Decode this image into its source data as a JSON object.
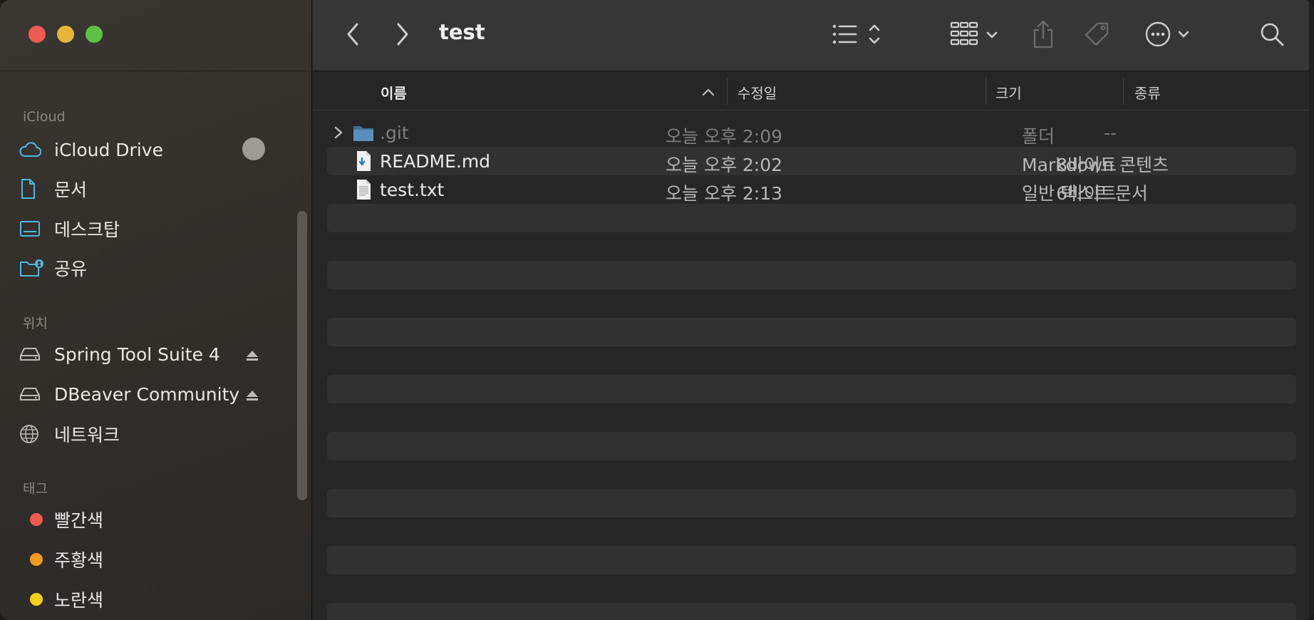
{
  "window": {
    "title": "test"
  },
  "sidebar": {
    "sections": {
      "icloud": "iCloud",
      "locations": "위치",
      "tags": "태그"
    },
    "icloud_items": [
      {
        "label": "iCloud Drive",
        "icon": "cloud-icon"
      },
      {
        "label": "문서",
        "icon": "document-icon"
      },
      {
        "label": "데스크탑",
        "icon": "desktop-icon"
      },
      {
        "label": "공유",
        "icon": "shared-folder-icon"
      }
    ],
    "location_items": [
      {
        "label": "Spring Tool Suite 4",
        "icon": "drive-icon",
        "ejectable": true
      },
      {
        "label": "DBeaver Community",
        "icon": "drive-icon",
        "ejectable": true
      },
      {
        "label": "네트워크",
        "icon": "globe-icon",
        "ejectable": false
      }
    ],
    "tag_items": [
      {
        "label": "빨간색",
        "color": "#ee5b52"
      },
      {
        "label": "주황색",
        "color": "#f39c1f"
      },
      {
        "label": "노란색",
        "color": "#f5d018"
      }
    ]
  },
  "columns": {
    "name": "이름",
    "modified": "수정일",
    "size": "크기",
    "kind": "종류"
  },
  "files": [
    {
      "name": ".git",
      "modified": "오늘 오후 2:09",
      "size": "--",
      "kind": "폴더",
      "type": "folder",
      "dimmed": true
    },
    {
      "name": "README.md",
      "modified": "오늘 오후 2:02",
      "size": "8바이트",
      "kind": "Markdown 콘텐츠",
      "type": "markdown",
      "dimmed": false
    },
    {
      "name": "test.txt",
      "modified": "오늘 오후 2:13",
      "size": "6바이트",
      "kind": "일반 텍스트 문서",
      "type": "text",
      "dimmed": false
    }
  ],
  "colors": {
    "accent": "#4fb8e0",
    "sidebar_bg": "#34302c",
    "main_bg": "#262626",
    "toolbar_bg": "#363636"
  }
}
